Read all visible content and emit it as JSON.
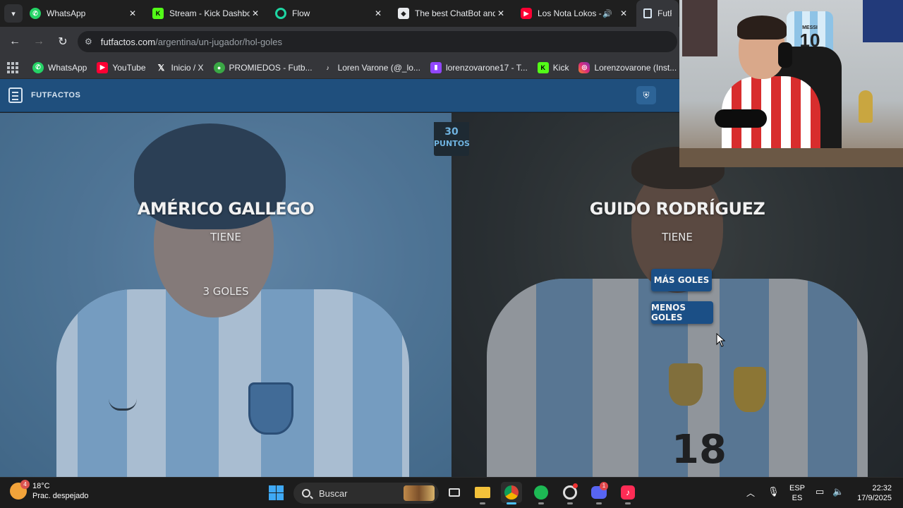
{
  "browser": {
    "tabs": [
      {
        "title": "WhatsApp",
        "icon": "whatsapp-icon",
        "color": "#25d366"
      },
      {
        "title": "Stream - Kick Dashbo",
        "icon": "kick-icon",
        "color": "#53fc18"
      },
      {
        "title": "Flow",
        "icon": "flow-icon",
        "color": "#1ed6a3"
      },
      {
        "title": "The best ChatBot and",
        "icon": "chatbot-icon",
        "color": "#ffffff"
      },
      {
        "title": "Los Nota Lokos -",
        "icon": "youtube-icon",
        "color": "#ff0033"
      },
      {
        "title": "FutFac",
        "icon": "futfactos-icon",
        "color": "#d7e4f0"
      }
    ],
    "url_host": "futfactos.com",
    "url_path": "/argentina/un-jugador/hol-goles",
    "bookmarks": [
      {
        "label": "WhatsApp",
        "icon": "whatsapp-icon",
        "color": "#25d366"
      },
      {
        "label": "YouTube",
        "icon": "youtube-icon",
        "color": "#ff0033"
      },
      {
        "label": "Inicio / X",
        "icon": "x-icon",
        "color": "#000000"
      },
      {
        "label": "PROMIEDOS - Futb...",
        "icon": "promiedos-icon",
        "color": "#3aa845"
      },
      {
        "label": "Loren Varone (@_lo...",
        "icon": "tiktok-icon",
        "color": "#111111"
      },
      {
        "label": "lorenzovarone17 - T...",
        "icon": "twitch-icon",
        "color": "#9146ff"
      },
      {
        "label": "Kick",
        "icon": "kick-icon",
        "color": "#53fc18"
      },
      {
        "label": "Lorenzovarone (Inst...",
        "icon": "instagram-icon",
        "color": "#e1306c"
      }
    ]
  },
  "site": {
    "logo_text": "FUTFACTOS",
    "accent": "#1f4f7d"
  },
  "game": {
    "score_value": "30",
    "score_label": "PUNTOS",
    "left_player": {
      "name": "AMÉRICO GALLEGO",
      "has": "TIENE",
      "goals": "3 GOLES"
    },
    "right_player": {
      "name": "GUIDO RODRÍGUEZ",
      "has": "TIENE"
    },
    "more_button": "MÁS GOLES",
    "less_button": "MENOS GOLES"
  },
  "webcam": {
    "jersey_name": "MESSI",
    "jersey_number": "10"
  },
  "taskbar": {
    "weather_temp": "18°C",
    "weather_desc": "Prac. despejado",
    "weather_badge": "4",
    "search_placeholder": "Buscar",
    "lang_top": "ESP",
    "lang_bottom": "ES",
    "time": "22:32",
    "date": "17/9/2025",
    "discord_badge": "1"
  }
}
